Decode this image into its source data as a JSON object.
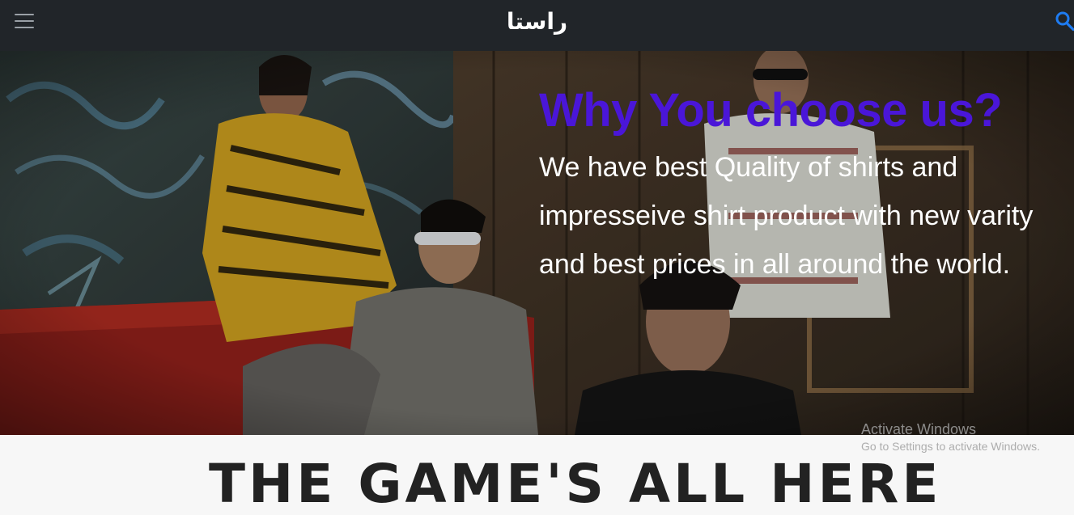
{
  "navbar": {
    "brand": "راستا",
    "menu_icon": "hamburger-menu-icon",
    "search_icon": "search-icon",
    "background": "#212529",
    "search_icon_color": "#1e7cf2"
  },
  "hero": {
    "title": "Why You choose us?",
    "body": "We have best Quality of shirts and impresseive shirt product with new varity and best prices in all around the world.",
    "title_color": "#4a16d8",
    "image_description_icon": "fashion-photo"
  },
  "section": {
    "heading": "THE GAME'S ALL HERE"
  },
  "watermark": {
    "title": "Activate Windows",
    "subtitle": "Go to Settings to activate Windows."
  }
}
